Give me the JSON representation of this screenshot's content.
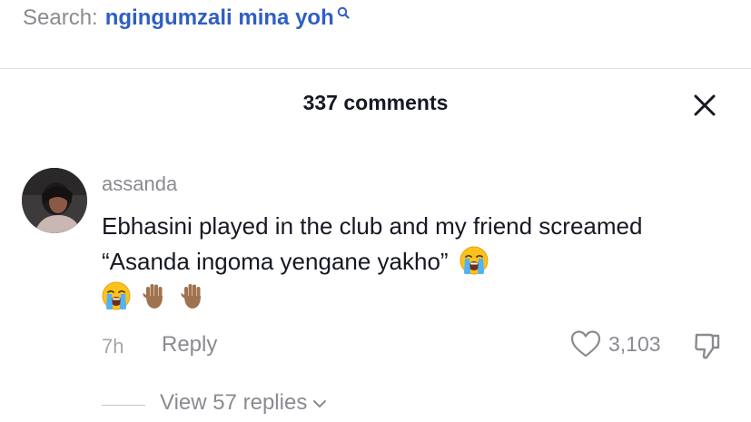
{
  "search": {
    "prefix": "Search:",
    "query": "ngingumzali mina yoh"
  },
  "header": {
    "title": "337 comments"
  },
  "comment": {
    "username": "assanda",
    "text": "Ebhasini played in the club and my friend screamed “Asanda ingoma yengane yakho”",
    "emojis": [
      "loudly-crying-face",
      "loudly-crying-face",
      "raised-hand-medium-dark",
      "raised-hand-medium-dark"
    ],
    "time": "7h",
    "reply_label": "Reply",
    "like_count": "3,103",
    "view_replies_label": "View 57 replies"
  },
  "colors": {
    "query": "#2f5ec4",
    "muted": "#8a8b91",
    "text": "#161823",
    "hand": "#a0734e"
  }
}
